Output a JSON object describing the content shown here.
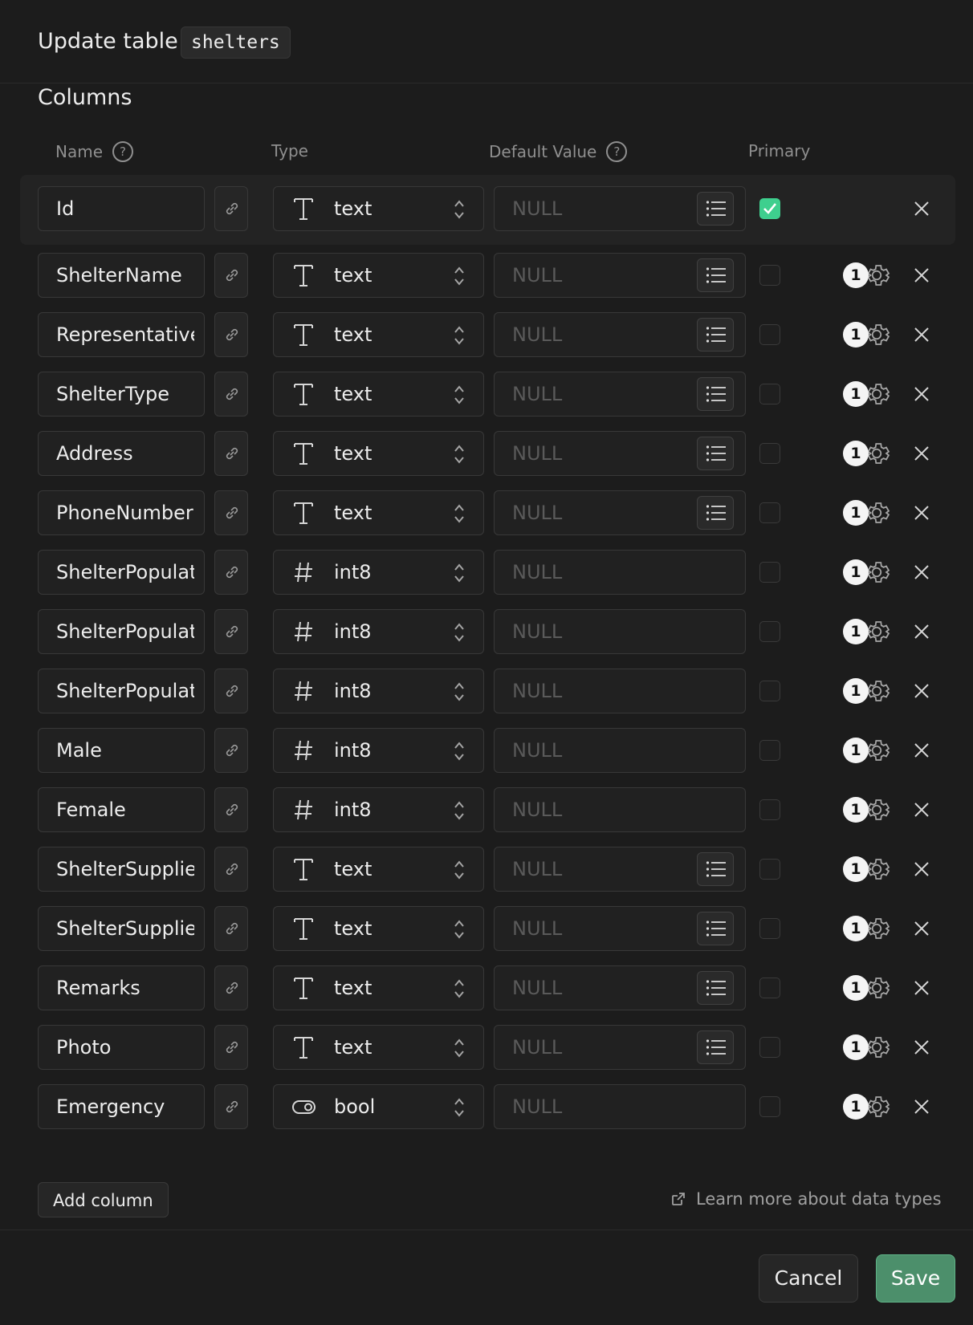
{
  "dialog": {
    "title": "Update table",
    "table_name": "shelters",
    "section_title": "Columns",
    "headers": {
      "name": "Name",
      "type": "Type",
      "default_value": "Default Value",
      "primary": "Primary"
    },
    "help_glyph": "?"
  },
  "colors": {
    "accent": "#3ecf8e",
    "save_bg": "#4c8f6b",
    "background": "#1c1c1c"
  },
  "columns": [
    {
      "name": "Id",
      "type": "text",
      "type_icon": "text-type-icon",
      "default": "NULL",
      "has_list": true,
      "primary": true,
      "badge": ""
    },
    {
      "name": "ShelterName",
      "type": "text",
      "type_icon": "text-type-icon",
      "default": "NULL",
      "has_list": true,
      "primary": false,
      "badge": "1"
    },
    {
      "name": "Representative",
      "type": "text",
      "type_icon": "text-type-icon",
      "default": "NULL",
      "has_list": true,
      "primary": false,
      "badge": "1"
    },
    {
      "name": "ShelterType",
      "type": "text",
      "type_icon": "text-type-icon",
      "default": "NULL",
      "has_list": true,
      "primary": false,
      "badge": "1"
    },
    {
      "name": "Address",
      "type": "text",
      "type_icon": "text-type-icon",
      "default": "NULL",
      "has_list": true,
      "primary": false,
      "badge": "1"
    },
    {
      "name": "PhoneNumber",
      "type": "text",
      "type_icon": "text-type-icon",
      "default": "NULL",
      "has_list": true,
      "primary": false,
      "badge": "1"
    },
    {
      "name": "ShelterPopulat",
      "type": "int8",
      "type_icon": "hash-type-icon",
      "default": "NULL",
      "has_list": false,
      "primary": false,
      "badge": "1"
    },
    {
      "name": "ShelterPopulat",
      "type": "int8",
      "type_icon": "hash-type-icon",
      "default": "NULL",
      "has_list": false,
      "primary": false,
      "badge": "1"
    },
    {
      "name": "ShelterPopulat",
      "type": "int8",
      "type_icon": "hash-type-icon",
      "default": "NULL",
      "has_list": false,
      "primary": false,
      "badge": "1"
    },
    {
      "name": "Male",
      "type": "int8",
      "type_icon": "hash-type-icon",
      "default": "NULL",
      "has_list": false,
      "primary": false,
      "badge": "1"
    },
    {
      "name": "Female",
      "type": "int8",
      "type_icon": "hash-type-icon",
      "default": "NULL",
      "has_list": false,
      "primary": false,
      "badge": "1"
    },
    {
      "name": "ShelterSupplie",
      "type": "text",
      "type_icon": "text-type-icon",
      "default": "NULL",
      "has_list": true,
      "primary": false,
      "badge": "1"
    },
    {
      "name": "ShelterSupplie",
      "type": "text",
      "type_icon": "text-type-icon",
      "default": "NULL",
      "has_list": true,
      "primary": false,
      "badge": "1"
    },
    {
      "name": "Remarks",
      "type": "text",
      "type_icon": "text-type-icon",
      "default": "NULL",
      "has_list": true,
      "primary": false,
      "badge": "1"
    },
    {
      "name": "Photo",
      "type": "text",
      "type_icon": "text-type-icon",
      "default": "NULL",
      "has_list": true,
      "primary": false,
      "badge": "1"
    },
    {
      "name": "Emergency",
      "type": "bool",
      "type_icon": "toggle-type-icon",
      "default": "NULL",
      "has_list": false,
      "primary": false,
      "badge": "1"
    }
  ],
  "footer": {
    "add_column": "Add column",
    "learn_more": "Learn more about data types",
    "cancel": "Cancel",
    "save": "Save"
  }
}
